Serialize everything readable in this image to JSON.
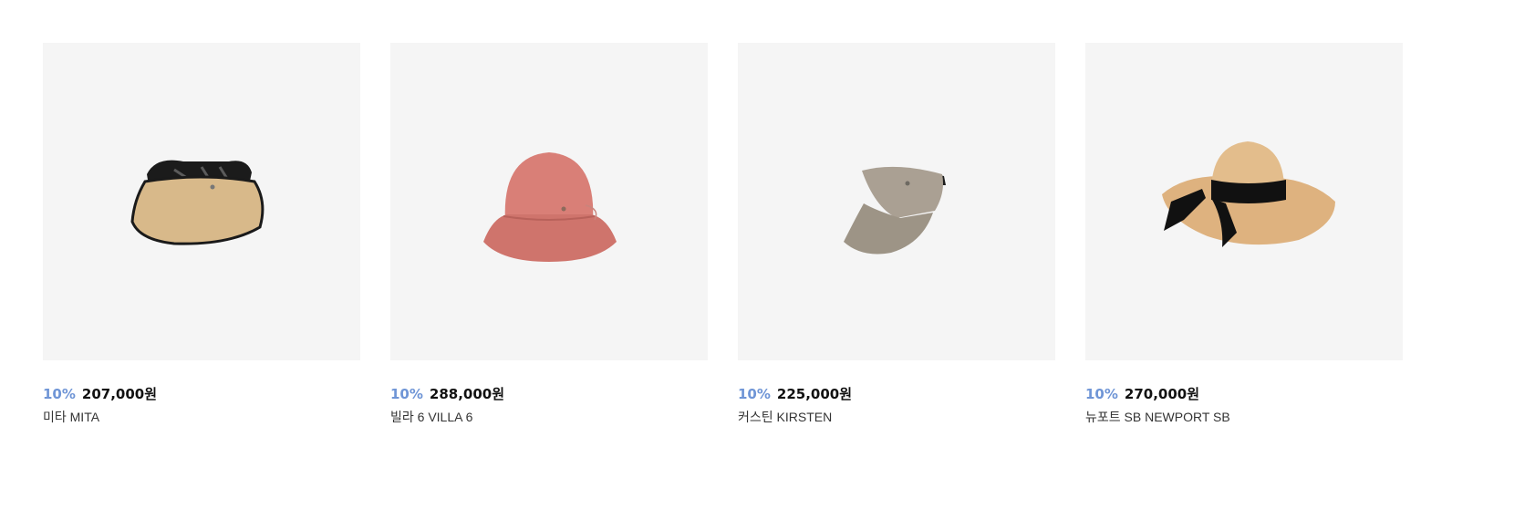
{
  "colors": {
    "discount": "#6f95d6",
    "price": "#111111",
    "name": "#333333",
    "thumb_bg": "#f5f5f5"
  },
  "products": [
    {
      "discount": "10%",
      "price": "207,000원",
      "name": "미타 MITA",
      "image_icon": "visor-hat-icon"
    },
    {
      "discount": "10%",
      "price": "288,000원",
      "name": "빌라 6 VILLA 6",
      "image_icon": "bucket-hat-icon"
    },
    {
      "discount": "10%",
      "price": "225,000원",
      "name": "커스틴 KIRSTEN",
      "image_icon": "sun-visor-icon"
    },
    {
      "discount": "10%",
      "price": "270,000원",
      "name": "뉴포트 SB NEWPORT SB",
      "image_icon": "wide-brim-hat-icon"
    }
  ]
}
